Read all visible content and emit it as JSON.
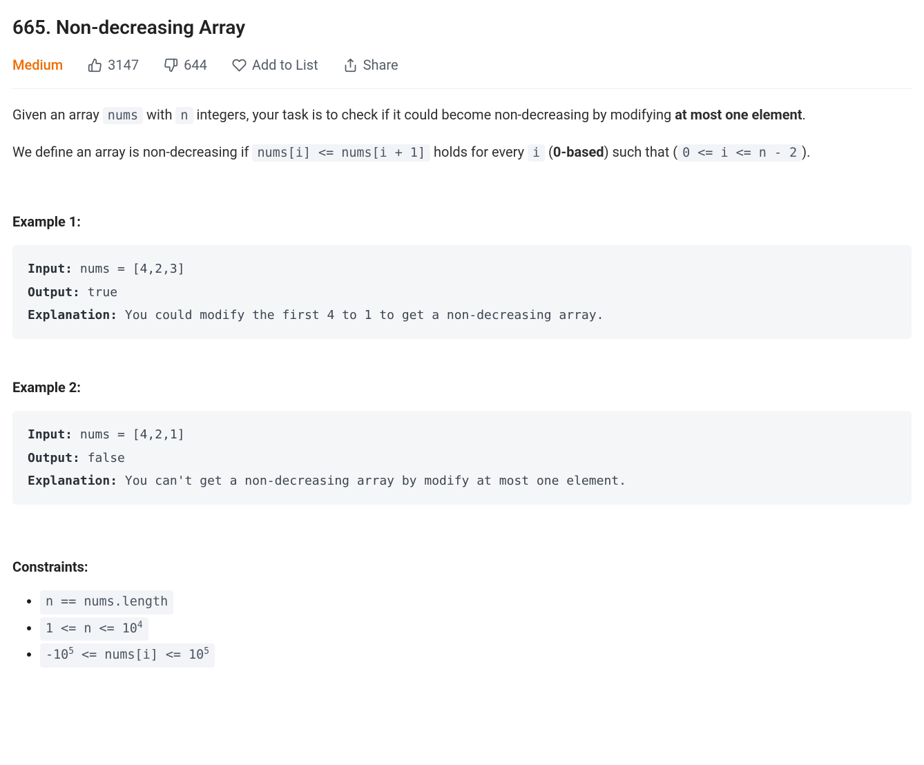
{
  "title": "665. Non-decreasing Array",
  "meta": {
    "difficulty": "Medium",
    "likes": "3147",
    "dislikes": "644",
    "addToList": "Add to List",
    "share": "Share"
  },
  "desc": {
    "p1_a": "Given an array ",
    "p1_code1": "nums",
    "p1_b": " with ",
    "p1_code2": "n",
    "p1_c": " integers, your task is to check if it could become non-decreasing by modifying ",
    "p1_bold": "at most one element",
    "p1_d": ".",
    "p2_a": "We define an array is non-decreasing if ",
    "p2_code1": "nums[i] <= nums[i + 1]",
    "p2_b": " holds for every ",
    "p2_code2": "i",
    "p2_c": " (",
    "p2_bold": "0-based",
    "p2_d": ") such that (",
    "p2_code3": "0 <= i <= n - 2",
    "p2_e": ")."
  },
  "examples": [
    {
      "heading": "Example 1:",
      "input_label": "Input:",
      "input_val": " nums = [4,2,3]",
      "output_label": "Output:",
      "output_val": " true",
      "explanation_label": "Explanation:",
      "explanation_val": " You could modify the first 4 to 1 to get a non-decreasing array."
    },
    {
      "heading": "Example 2:",
      "input_label": "Input:",
      "input_val": " nums = [4,2,1]",
      "output_label": "Output:",
      "output_val": " false",
      "explanation_label": "Explanation:",
      "explanation_val": " You can't get a non-decreasing array by modify at most one element."
    }
  ],
  "constraints": {
    "heading": "Constraints:",
    "items": [
      {
        "pre": "n == nums.length",
        "sup": "",
        "post": ""
      },
      {
        "pre": "1 <= n <= 10",
        "sup": "4",
        "post": ""
      },
      {
        "pre": "-10",
        "sup": "5",
        "mid": " <= nums[i] <= 10",
        "sup2": "5",
        "post": ""
      }
    ]
  }
}
